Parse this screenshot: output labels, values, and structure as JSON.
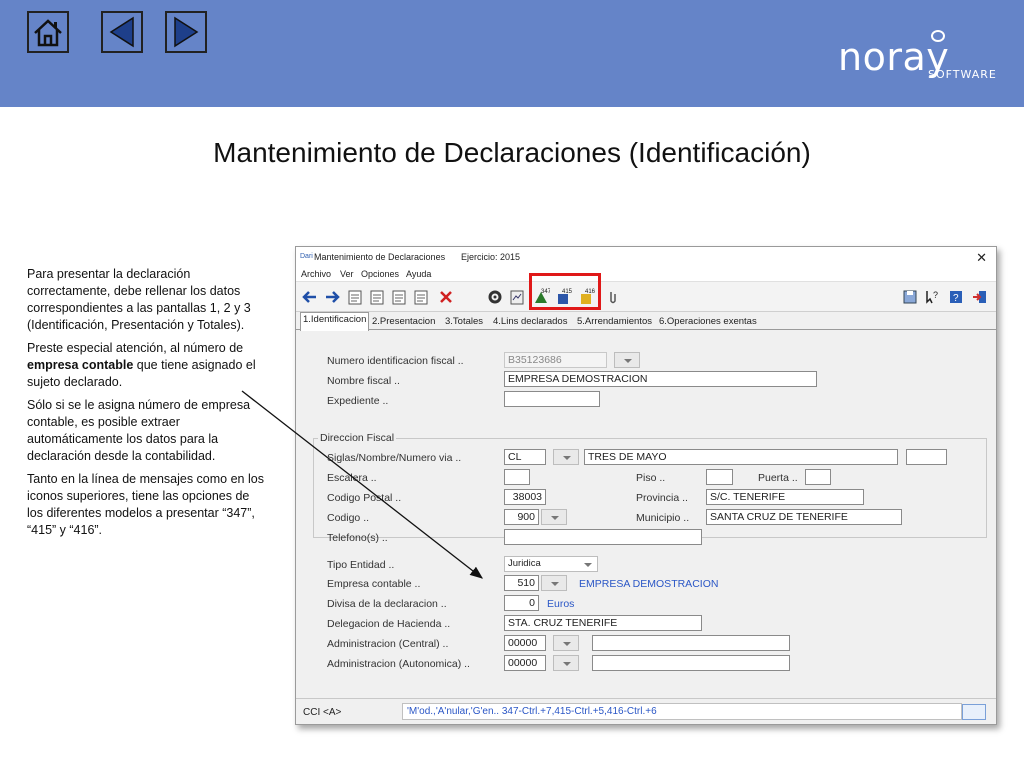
{
  "slide": {
    "title": "Mantenimiento de Declaraciones (Identificación)",
    "nav": {
      "home_icon": "home-icon",
      "back_icon": "triangle-left-icon",
      "forward_icon": "triangle-right-icon"
    },
    "logo": {
      "name": "noray",
      "sub": "SOFTWARE"
    },
    "description": {
      "p1": "Para presentar la declaración correctamente, debe rellenar los datos correspondientes a las pantallas 1, 2 y 3 (Identificación, Presentación y Totales).",
      "p2_pre": "Preste especial atención, al número de ",
      "p2_bold": "empresa contable",
      "p2_post": " que tiene asignado el sujeto declarado.",
      "p3": "Sólo si se le asigna número de empresa contable, es posible extraer automáticamente los datos para la declaración desde la contabilidad.",
      "p4": "Tanto en la línea de mensajes como en los iconos superiores, tiene las opciones de los diferentes modelos a presentar “347”, “415” y “416”."
    },
    "colors": {
      "banner": "#6584c8",
      "highlight": "#e01818",
      "link_blue": "#2a56c6"
    }
  },
  "window": {
    "app_icon": "Dari",
    "title": "Mantenimiento de Declaraciones",
    "ejercicio": "Ejercicio: 2015",
    "close": "✕",
    "menu": [
      "Archivo",
      "Ver",
      "Opciones",
      "Ayuda"
    ],
    "toolbar": {
      "m347": "347",
      "m415": "415",
      "m416": "416"
    },
    "tabs": [
      "1.Identificacion",
      "2.Presentacion",
      "3.Totales",
      "4.Lins declarados",
      "5.Arrendamientos",
      "6.Operaciones exentas"
    ],
    "form": {
      "nif_label": "Numero identificacion fiscal ..",
      "nif_value": "B35123686",
      "nombre_label": "Nombre fiscal ..",
      "nombre_value": "EMPRESA DEMOSTRACION",
      "expediente_label": "Expediente ..",
      "expediente_value": "",
      "direccion_group": "Direccion Fiscal",
      "siglas_label": "Siglas/Nombre/Numero via ..",
      "siglas_value": "CL",
      "via_value": "TRES DE MAYO",
      "numero_value": "",
      "escalera_label": "Escalera ..",
      "piso_label": "Piso ..",
      "puerta_label": "Puerta ..",
      "cp_label": "Codigo Postal ..",
      "cp_value": "38003",
      "provincia_label": "Provincia ..",
      "provincia_value": "S/C. TENERIFE",
      "codigo_label": "Codigo ..",
      "codigo_value": "900",
      "municipio_label": "Municipio ..",
      "municipio_value": "SANTA CRUZ DE TENERIFE",
      "telefono_label": "Telefono(s) ..",
      "tipo_label": "Tipo Entidad ..",
      "tipo_value": "Juridica",
      "empresa_label": "Empresa contable ..",
      "empresa_value": "510",
      "empresa_name": "EMPRESA DEMOSTRACION",
      "divisa_label": "Divisa de la declaracion ..",
      "divisa_value": "0",
      "divisa_name": "Euros",
      "delegacion_label": "Delegacion de Hacienda ..",
      "delegacion_value": "STA. CRUZ TENERIFE",
      "admin_central_label": "Administracion (Central) ..",
      "admin_central_value": "00000",
      "admin_auton_label": "Administracion (Autonomica) ..",
      "admin_auton_value": "00000"
    },
    "status": {
      "cci": "CCI <A>",
      "message": "'M'od.,'A'nular,'G'en.. 347-Ctrl.+7,415-Ctrl.+5,416-Ctrl.+6"
    }
  }
}
